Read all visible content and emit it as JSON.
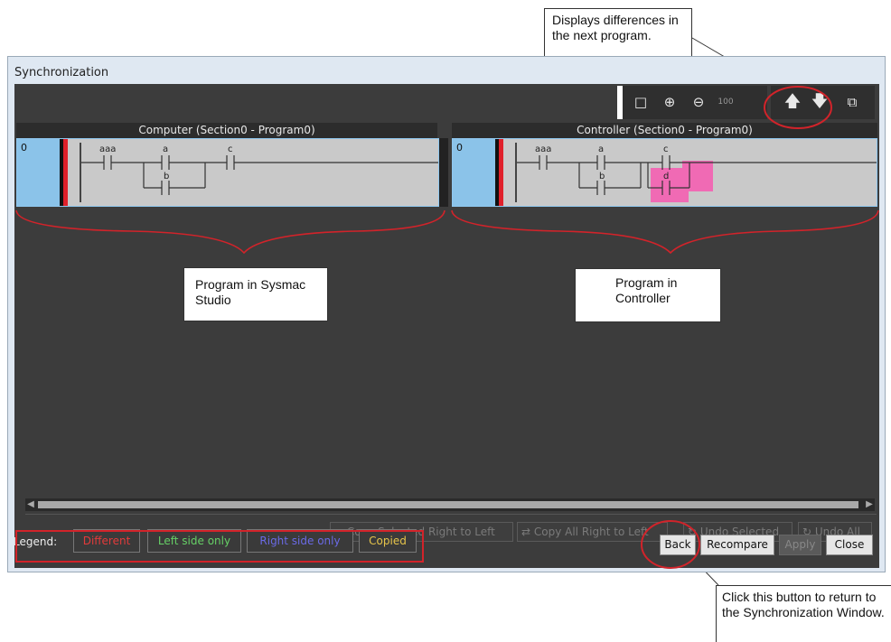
{
  "callouts": {
    "top": "Displays differences in the next program.",
    "program_left": "Program in Sysmac Studio",
    "program_right": "Program in Controller",
    "back_note": "Click this button to return to the Synchronization Window."
  },
  "window": {
    "title": "Synchronization"
  },
  "toolbar": {
    "icons": [
      "fit-view-icon",
      "zoom-in-icon",
      "zoom-out-icon",
      "zoom-100-icon",
      "previous-difference-icon",
      "next-difference-icon",
      "window-options-icon"
    ]
  },
  "panes": {
    "left": {
      "header": "Computer (Section0 - Program0)",
      "rung": "0",
      "contacts": [
        "aaa",
        "a",
        "c",
        "b"
      ]
    },
    "right": {
      "header": "Controller (Section0 - Program0)",
      "rung": "0",
      "contacts": [
        "aaa",
        "a",
        "c",
        "b",
        "d"
      ]
    }
  },
  "copy_buttons": {
    "copy_selected_rtl": "Copy Selected Right to Left",
    "copy_all_rtl": "Copy All Right to Left",
    "undo_selected": "Undo Selected",
    "undo_all": "Undo All"
  },
  "legend": {
    "label": "Legend:",
    "items": [
      {
        "label": "Different",
        "color": "#e33a3a"
      },
      {
        "label": "Left side only",
        "color": "#66d066"
      },
      {
        "label": "Right side only",
        "color": "#6a6ae6"
      },
      {
        "label": "Copied",
        "color": "#e6c44a"
      }
    ]
  },
  "actions": {
    "back": "Back",
    "recompare": "Recompare",
    "apply": "Apply",
    "close": "Close"
  },
  "colors": {
    "diff_highlight": "#f06ab4",
    "annotation_red": "#d2232a"
  }
}
